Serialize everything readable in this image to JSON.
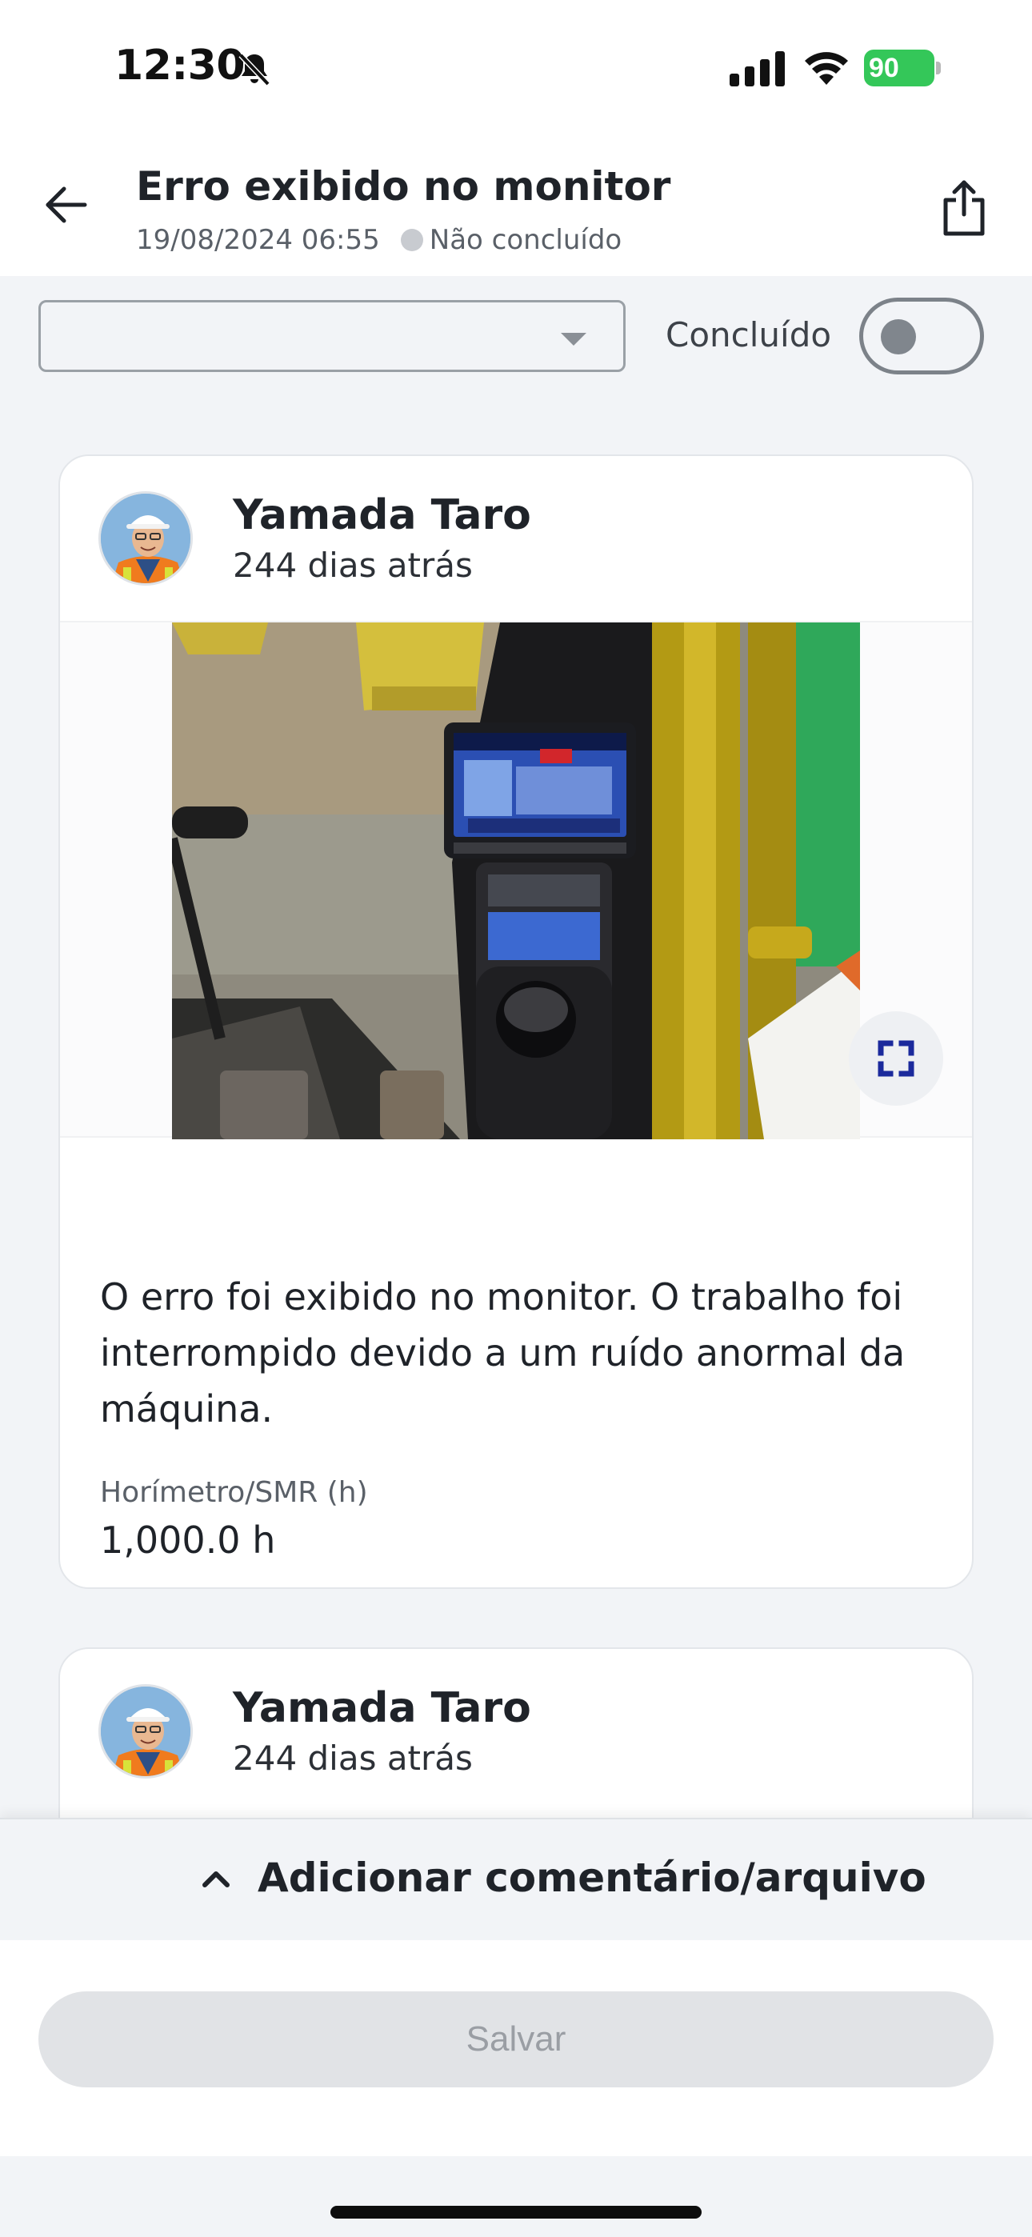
{
  "status_bar": {
    "time": "12:30",
    "battery": "90"
  },
  "header": {
    "title": "Erro exibido no monitor",
    "datetime": "19/08/2024 06:55",
    "status": "Não concluído"
  },
  "filter": {
    "select_value": "",
    "toggle_label": "Concluído",
    "toggle_on": false
  },
  "comments": [
    {
      "author": "Yamada Taro",
      "time_ago": "244 dias atrás",
      "text": "O erro foi exibido no monitor. O trabalho foi interrompido devido a um ruído anormal da máquina.",
      "smr_label": "Horímetro/SMR (h)",
      "smr_value": "1,000.0 h"
    },
    {
      "author": "Yamada Taro",
      "time_ago": "244 dias atrás"
    }
  ],
  "bottom": {
    "add_label": "Adicionar comentário/arquivo",
    "save_label": "Salvar"
  }
}
